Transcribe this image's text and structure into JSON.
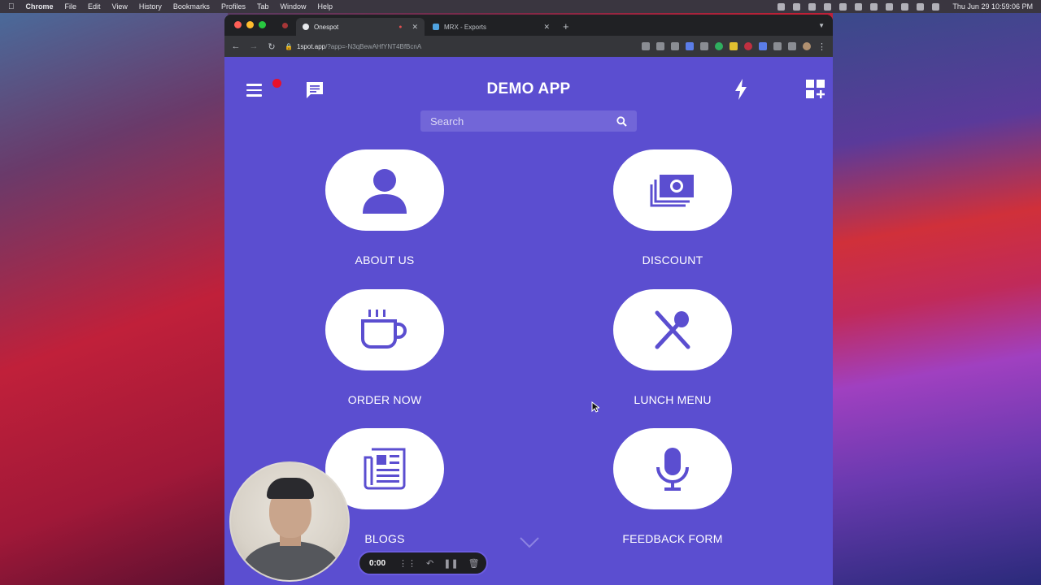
{
  "menubar": {
    "app_name": "Chrome",
    "menus": [
      "File",
      "Edit",
      "View",
      "History",
      "Bookmarks",
      "Profiles",
      "Tab",
      "Window",
      "Help"
    ],
    "clock": "Thu Jun 29  10:59:06 PM"
  },
  "browser": {
    "tabs": [
      {
        "title": "Onespot",
        "active": true
      },
      {
        "title": "MRX - Exports",
        "active": false
      }
    ],
    "url_host": "1spot.app",
    "url_path": "/?app=-N3qBewAHfYNT4BfBcnA"
  },
  "app": {
    "title": "DEMO APP",
    "search_placeholder": "Search",
    "tiles": [
      {
        "label": "ABOUT US",
        "icon": "person-icon"
      },
      {
        "label": "DISCOUNT",
        "icon": "money-icon"
      },
      {
        "label": "ORDER NOW",
        "icon": "coffee-cup-icon"
      },
      {
        "label": "LUNCH MENU",
        "icon": "utensils-icon"
      },
      {
        "label": "BLOGS",
        "icon": "newspaper-icon"
      },
      {
        "label": "FEEDBACK FORM",
        "icon": "microphone-icon"
      }
    ],
    "accent_color": "#5b4ed0",
    "notification_color": "#e8102a"
  },
  "recorder": {
    "timer": "0:00"
  }
}
